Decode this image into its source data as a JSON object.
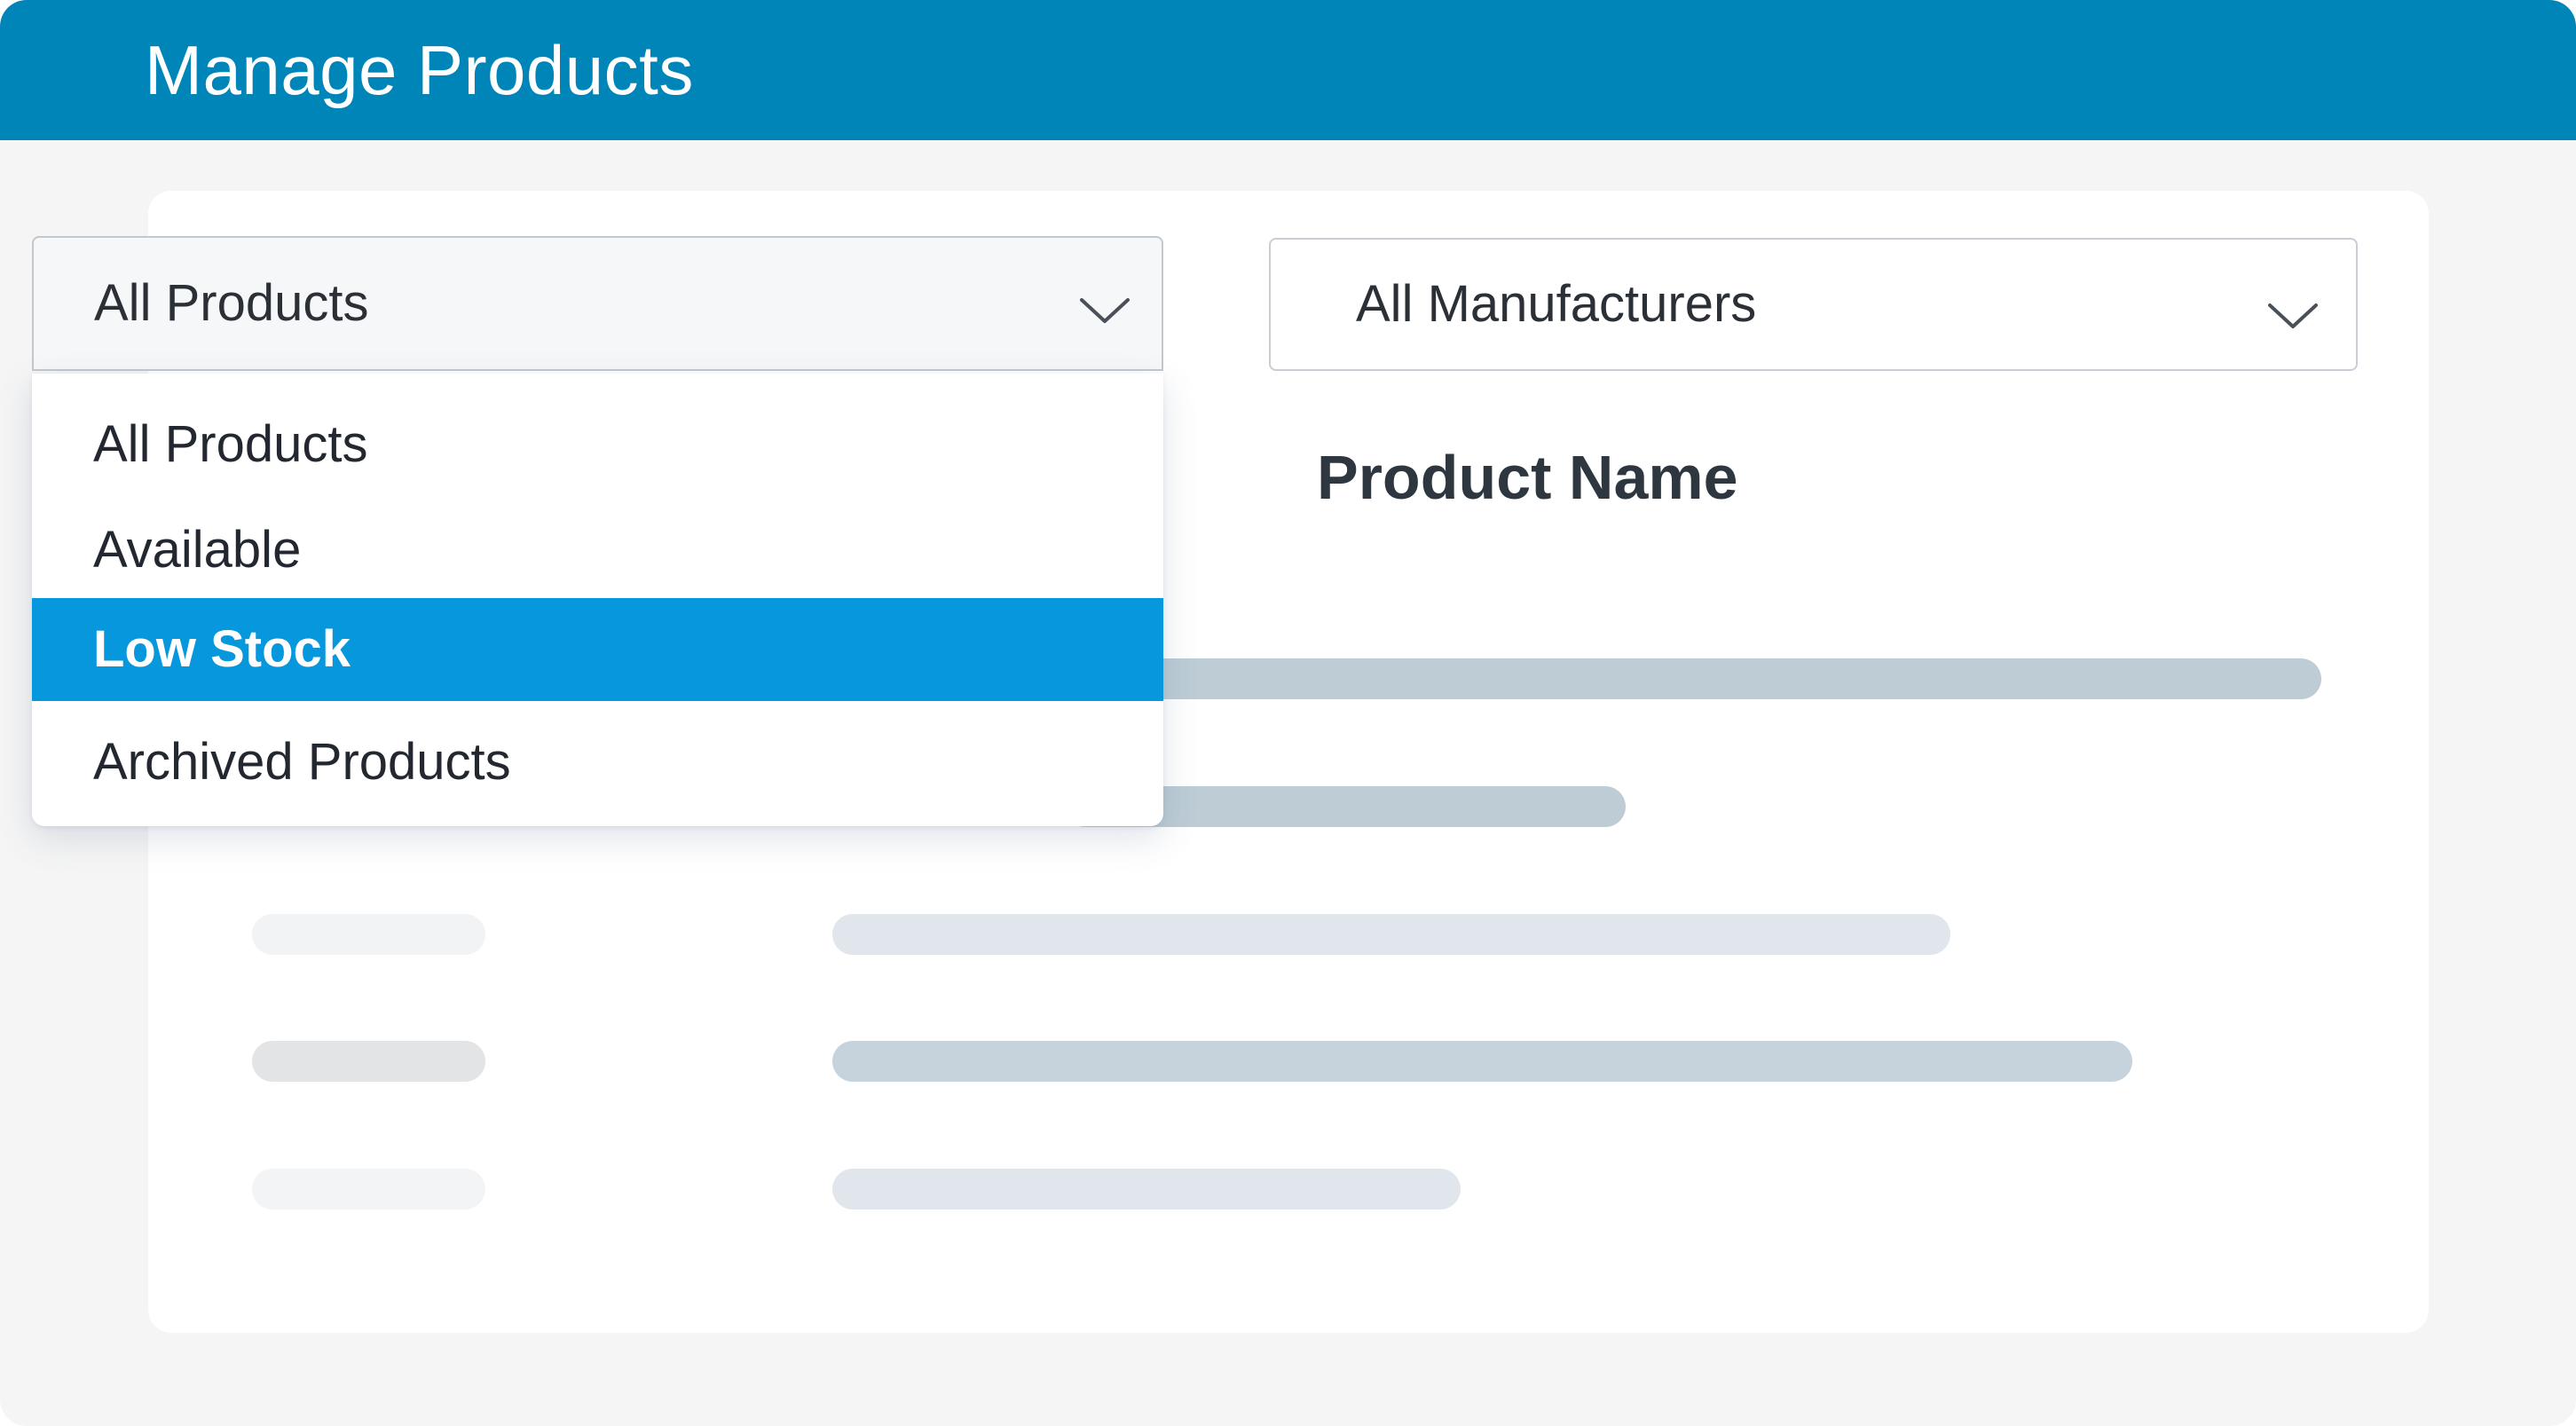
{
  "window": {
    "title": "Manage Products",
    "accent_color": "#0085b8"
  },
  "filters": {
    "product_filter": {
      "selected": "All Products",
      "icon": "chevron-down-icon",
      "expanded": true,
      "options": [
        {
          "label": "All Products",
          "highlighted": false
        },
        {
          "label": "Available",
          "highlighted": false
        },
        {
          "label": "Low Stock",
          "highlighted": true
        },
        {
          "label": "Archived Products",
          "highlighted": false
        }
      ],
      "highlight_color": "#0797dd"
    },
    "manufacturer_filter": {
      "selected": "All Manufacturers",
      "icon": "chevron-down-icon"
    }
  },
  "table": {
    "column_header": "Product Name"
  }
}
